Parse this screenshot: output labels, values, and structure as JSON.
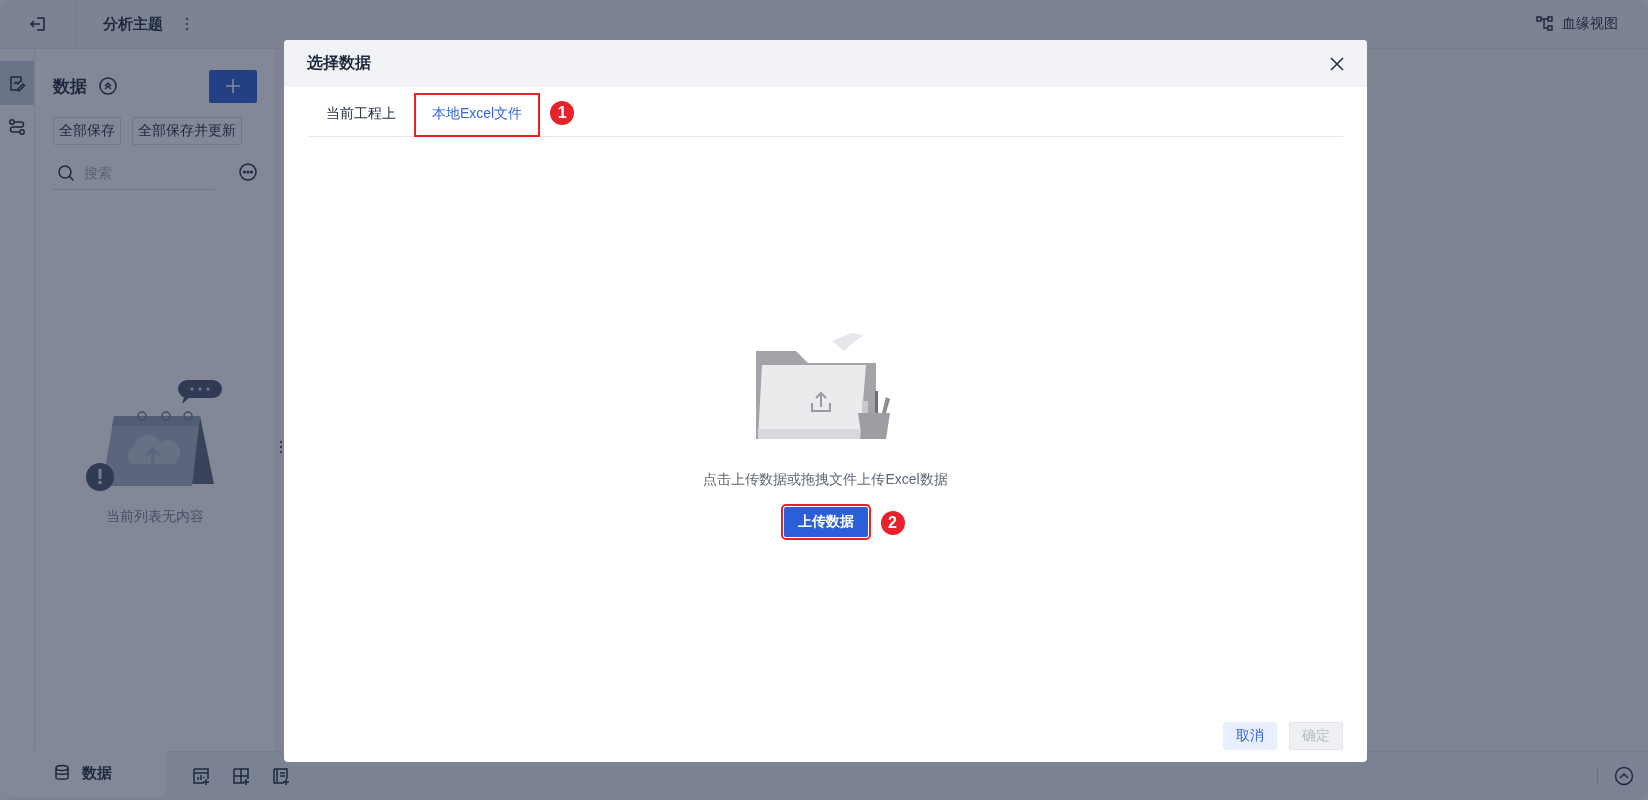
{
  "topbar": {
    "title": "分析主题",
    "lineage_label": "血缘视图"
  },
  "rail": [
    {
      "selected": true
    },
    {
      "selected": false
    }
  ],
  "panel": {
    "title": "数据",
    "buttons": [
      "全部保存",
      "全部保存并更新"
    ],
    "search": {
      "placeholder": "搜索"
    },
    "empty_text": "当前列表无内容"
  },
  "bottom_bar": {
    "tab": "数据"
  },
  "dialog": {
    "title": "选择数据",
    "tabs": [
      {
        "label": "当前工程上",
        "selected": false
      },
      {
        "label": "本地Excel文件",
        "selected": true,
        "callout": "1"
      }
    ],
    "hint": "点击上传数据或拖拽文件上传Excel数据",
    "upload_button": {
      "label": "上传数据",
      "callout": "2"
    },
    "footer": [
      {
        "label": "取消",
        "disabled": false
      },
      {
        "label": "确定",
        "disabled": true
      }
    ]
  }
}
